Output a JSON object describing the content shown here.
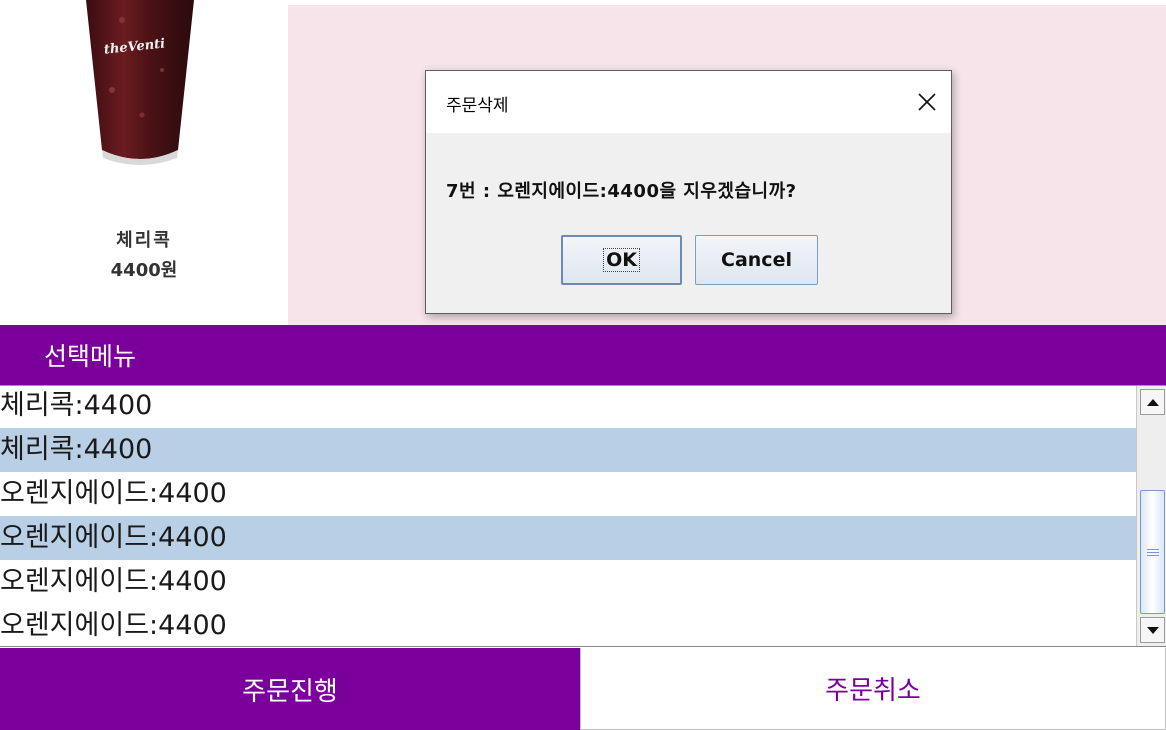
{
  "product": {
    "name": "체리콕",
    "price": "4400원",
    "cup_logo": "theVenti"
  },
  "menu_header": {
    "title": "선택메뉴"
  },
  "order_list": {
    "items": [
      {
        "label": "체리콕:4400",
        "selected": false
      },
      {
        "label": "체리콕:4400",
        "selected": true
      },
      {
        "label": "오렌지에이드:4400",
        "selected": false
      },
      {
        "label": "오렌지에이드:4400",
        "selected": true
      },
      {
        "label": "오렌지에이드:4400",
        "selected": false
      },
      {
        "label": "오렌지에이드:4400",
        "selected": false
      }
    ]
  },
  "buttons": {
    "proceed": "주문진행",
    "cancel_order": "주문취소"
  },
  "dialog": {
    "title": "주문삭제",
    "message": "7번 : 오렌지에이드:4400을 지우겠습니까?",
    "ok": "OK",
    "cancel": "Cancel",
    "close_icon": "close-icon"
  },
  "colors": {
    "accent": "#7b009b",
    "pink_bg": "#f6e4ea",
    "selection": "#b8cfe5"
  }
}
